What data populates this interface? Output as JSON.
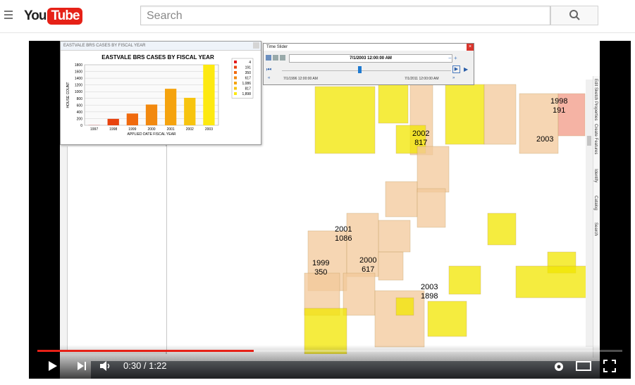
{
  "header": {
    "logo_you": "You",
    "logo_tube": "Tube",
    "search_placeholder": "Search"
  },
  "chart_window": {
    "title": "EASTVALE BRS CASES BY FISCAL YEAR"
  },
  "chart_data": {
    "type": "bar",
    "title": "EASTVALE BRS CASES BY FISCAL YEAR",
    "xlabel": "APPLIED DATE FISCAL YEAR",
    "ylabel": "HOUSE COUNT",
    "categories": [
      "1997",
      "1998",
      "1999",
      "2000",
      "2001",
      "2002",
      "2003"
    ],
    "values": [
      4,
      191,
      350,
      617,
      1086,
      817,
      1898
    ],
    "ylim": [
      0,
      1800
    ],
    "yticks": [
      "0",
      "200",
      "400",
      "600",
      "800",
      "1000",
      "1200",
      "1400",
      "1600",
      "1800"
    ],
    "colors": [
      "#e31a1c",
      "#e8430f",
      "#f06a0e",
      "#f2890f",
      "#f5a30e",
      "#f7c40f",
      "#fde910"
    ],
    "legend": [
      "4",
      "191",
      "350",
      "617",
      "1,086",
      "817",
      "1,898"
    ],
    "legend_position": "right",
    "grid": true
  },
  "time_slider": {
    "title": "Time Slider",
    "current": "7/1/2003 12:00:00 AM",
    "start": "7/1/1996 12:00:00 AM",
    "end": "7/1/2011 12:00:00 AM",
    "close": "×"
  },
  "map_labels": [
    {
      "year": "1998",
      "count": "191"
    },
    {
      "year": "2002",
      "count": "817"
    },
    {
      "year": "2003",
      "count": ""
    },
    {
      "year": "2001",
      "count": "1086"
    },
    {
      "year": "1999",
      "count": "350"
    },
    {
      "year": "2000",
      "count": "617"
    },
    {
      "year": "2003",
      "count": "1898"
    }
  ],
  "side_tabs": [
    "Edit Sketch Properties",
    "Create Features",
    "Identify",
    "Catalog",
    "Search"
  ],
  "player": {
    "time": "0:30 / 1:22",
    "progress": 0.37
  },
  "colors": {
    "youtube_red": "#e62117",
    "map_tan": "#f3c99a",
    "map_yellow": "#f2e600"
  }
}
